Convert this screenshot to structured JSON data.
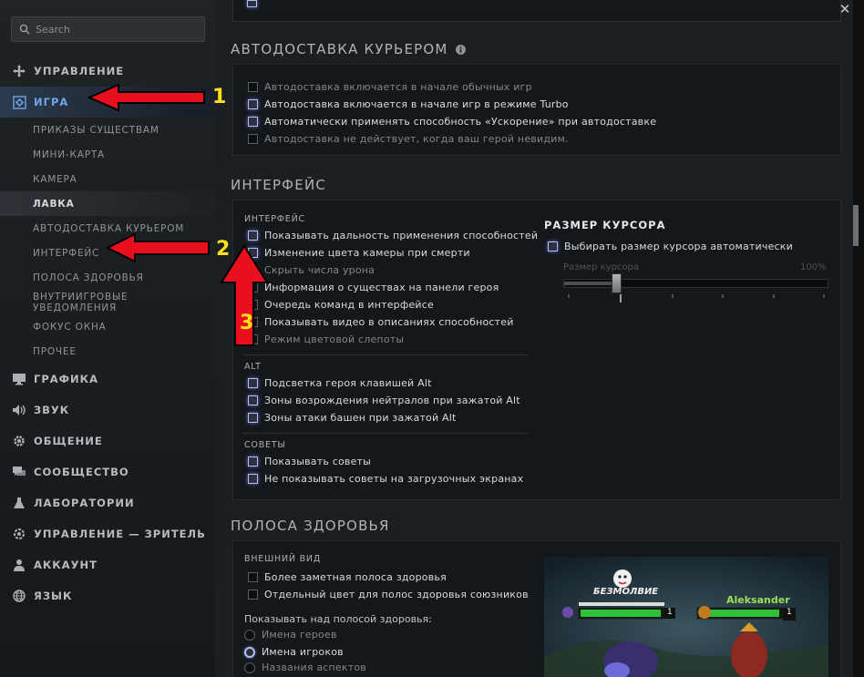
{
  "window": {
    "close_glyph": "✕"
  },
  "search": {
    "placeholder": "Search"
  },
  "sidebar": {
    "categories": [
      {
        "label": "УПРАВЛЕНИЕ",
        "icon": "controller-icon"
      },
      {
        "label": "ИГРА",
        "icon": "game-gear-icon",
        "active": true
      },
      {
        "label": "ГРАФИКА",
        "icon": "monitor-icon"
      },
      {
        "label": "ЗВУК",
        "icon": "speaker-icon"
      },
      {
        "label": "ОБЩЕНИЕ",
        "icon": "gear-icon"
      },
      {
        "label": "СООБЩЕСТВО",
        "icon": "chat-icon"
      },
      {
        "label": "ЛАБОРАТОРИИ",
        "icon": "flask-icon"
      },
      {
        "label": "УПРАВЛЕНИЕ — ЗРИТЕЛЬ",
        "icon": "eye-icon"
      },
      {
        "label": "АККАУНТ",
        "icon": "user-icon"
      },
      {
        "label": "ЯЗЫК",
        "icon": "globe-icon"
      }
    ],
    "subitems": [
      "ПРИКАЗЫ СУЩЕСТВАМ",
      "МИНИ-КАРТА",
      "КАМЕРА",
      "ЛАВКА",
      "АВТОДОСТАВКА КУРЬЕРОМ",
      "ИНТЕРФЕЙС",
      "ПОЛОСА ЗДОРОВЬЯ",
      "ВНУТРИИГРОВЫЕ УВЕДОМЛЕНИЯ",
      "ФОКУС ОКНА",
      "ПРОЧЕЕ"
    ]
  },
  "courier": {
    "title": "АВТОДОСТАВКА КУРЬЕРОМ",
    "info_icon": "info-icon",
    "options": [
      {
        "label": "Автодоставка включается в начале обычных игр",
        "checked": false,
        "dim": true
      },
      {
        "label": "Автодоставка включается в начале игр в режиме Turbo",
        "checked": true,
        "dim": false
      },
      {
        "label": "Автоматически применять способность «Ускорение» при автодоставке",
        "checked": true,
        "dim": false
      },
      {
        "label": "Автодоставка не действует, когда ваш герой невидим.",
        "checked": false,
        "dim": true
      }
    ]
  },
  "interface": {
    "title": "ИНТЕРФЕЙС",
    "group_interface": "ИНТЕРФЕЙС",
    "interface_options": [
      {
        "label": "Показывать дальность применения способностей",
        "checked": true
      },
      {
        "label": "Изменение цвета камеры при смерти",
        "checked": true
      },
      {
        "label": "Скрыть числа урона",
        "checked": false,
        "dim": true
      },
      {
        "label": "Информация о существах на панели героя",
        "checked": false
      },
      {
        "label": "Очередь команд в интерфейсе",
        "checked": false
      },
      {
        "label": "Показывать видео в описаниях способностей",
        "checked": false
      },
      {
        "label": "Режим цветовой слепоты",
        "checked": false,
        "dim": true
      }
    ],
    "group_alt": "ALT",
    "alt_options": [
      {
        "label": "Подсветка героя клавишей Alt",
        "checked": true
      },
      {
        "label": "Зоны возрождения нейтралов при зажатой Alt",
        "checked": true
      },
      {
        "label": "Зоны атаки башен при зажатой Alt",
        "checked": true
      }
    ],
    "group_tips": "СОВЕТЫ",
    "tips_options": [
      {
        "label": "Показывать советы",
        "checked": true
      },
      {
        "label": "Не показывать советы на загрузочных экранах",
        "checked": true
      }
    ],
    "cursor": {
      "title": "РАЗМЕР КУРСОРА",
      "auto_label": "Выбирать размер курсора автоматически",
      "auto_checked": true,
      "slider_label": "Размер курсора",
      "slider_max": "100%",
      "slider_value": 0.2
    }
  },
  "healthbar": {
    "title": "ПОЛОСА ЗДОРОВЬЯ",
    "group_look": "ВНЕШНИЙ ВИД",
    "look_options": [
      {
        "label": "Более заметная полоса здоровья",
        "checked": false
      },
      {
        "label": "Отдельный цвет для полос здоровья союзников",
        "checked": false
      }
    ],
    "show_above_label": "Показывать над полосой здоровья:",
    "radio_options": [
      {
        "label": "Имена героев",
        "selected": false,
        "dim": true
      },
      {
        "label": "Имена игроков",
        "selected": true,
        "dim": false
      },
      {
        "label": "Названия аспектов",
        "selected": false,
        "dim": true
      }
    ],
    "preview": {
      "player1": "БЕЗМОЛВИЕ",
      "player2": "Aleksander",
      "level1": "1",
      "level2": "1"
    }
  },
  "annotations": {
    "n1": "1",
    "n2": "2",
    "n3": "3",
    "color": "#e8101c"
  }
}
